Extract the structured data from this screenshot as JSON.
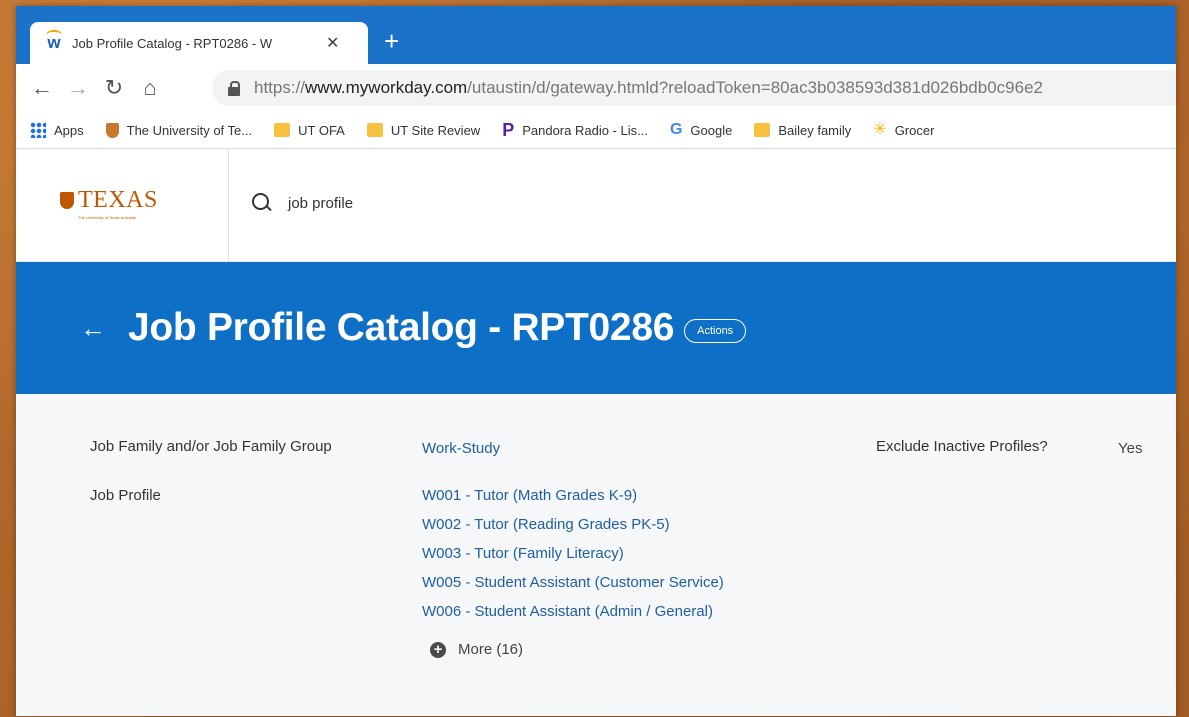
{
  "browser": {
    "tab": {
      "title": "Job Profile Catalog - RPT0286 - W",
      "favicon": "workday-favicon"
    },
    "new_tab_label": "+",
    "url": {
      "protocol": "https://",
      "host": "www.myworkday.com",
      "path": "/utaustin/d/gateway.htmld?reloadToken=80ac3b038593d381d026bdb0c96e2"
    },
    "bookmarks": [
      {
        "label": "Apps",
        "icon": "apps-grid-icon"
      },
      {
        "label": "The University of Te...",
        "icon": "ut-shield-icon"
      },
      {
        "label": "UT OFA",
        "icon": "folder-icon"
      },
      {
        "label": "UT Site Review",
        "icon": "folder-icon"
      },
      {
        "label": "Pandora Radio - Lis...",
        "icon": "pandora-icon"
      },
      {
        "label": "Google",
        "icon": "google-icon"
      },
      {
        "label": "Bailey family",
        "icon": "folder-icon"
      },
      {
        "label": "Grocer",
        "icon": "walmart-spark-icon"
      }
    ]
  },
  "header": {
    "logo_text": "TEXAS",
    "logo_subtext": "The University of Texas at Austin",
    "search_value": "job profile"
  },
  "page": {
    "title": "Job Profile Catalog - RPT0286",
    "actions_label": "Actions"
  },
  "fields": {
    "job_family_label": "Job Family and/or Job Family Group",
    "job_family_value": "Work-Study",
    "exclude_label": "Exclude Inactive Profiles?",
    "exclude_value": "Yes",
    "job_profile_label": "Job Profile",
    "job_profiles": [
      "W001 - Tutor (Math Grades K-9)",
      "W002 - Tutor (Reading Grades PK-5)",
      "W003 - Tutor (Family Literacy)",
      "W005 - Student Assistant (Customer Service)",
      "W006 - Student Assistant (Admin / General)"
    ],
    "more_label": "More (16)"
  },
  "colors": {
    "brand_blue": "#0e6fc7",
    "ut_orange": "#bf5700",
    "link": "#1f5fa5"
  }
}
